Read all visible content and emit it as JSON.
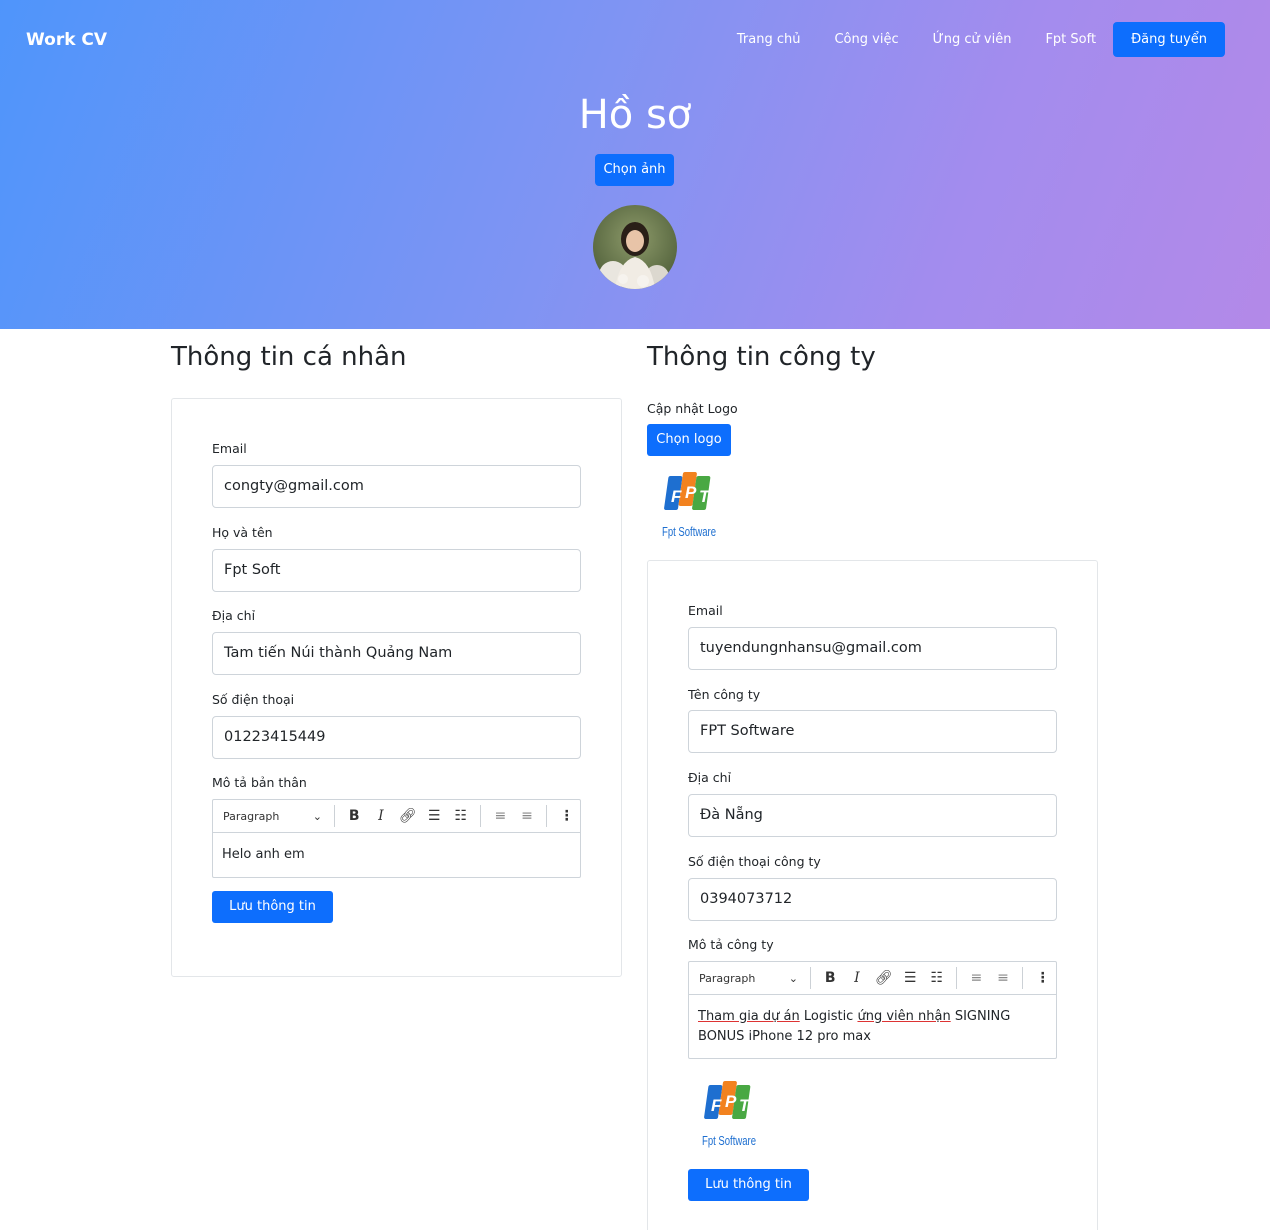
{
  "header": {
    "brand": "Work CV",
    "nav": [
      "Trang chủ",
      "Công việc",
      "Ứng cử viên",
      "Fpt Soft"
    ],
    "post_button": "Đăng tuyển"
  },
  "hero": {
    "title": "Hồ sơ",
    "choose_image_button": "Chọn ảnh"
  },
  "personal": {
    "title": "Thông tin cá nhân",
    "email_label": "Email",
    "email_value": "congty@gmail.com",
    "name_label": "Họ và tên",
    "name_value": "Fpt Soft",
    "address_label": "Địa chỉ",
    "address_value": "Tam tiến Núi thành Quảng Nam",
    "phone_label": "Số điện thoại",
    "phone_value": "01223415449",
    "desc_label": "Mô tả bản thân",
    "desc_value": "Helo anh em",
    "save_button": "Lưu thông tin"
  },
  "editor_toolbar": {
    "paragraph": "Paragraph"
  },
  "company": {
    "title": "Thông tin công ty",
    "logo_label": "Cập nhật Logo",
    "choose_logo_button": "Chọn logo",
    "logo_text": "Fpt Software",
    "email_label": "Email",
    "email_value": "tuyendungnhansu@gmail.com",
    "name_label": "Tên công ty",
    "name_value": "FPT Software",
    "address_label": "Địa chỉ",
    "address_value": "Đà Nẵng",
    "phone_label": "Số điện thoại công ty",
    "phone_value": "0394073712",
    "desc_label": "Mô tả công ty",
    "desc_underlined": "Tham gia dự án",
    "desc_rest": " Logistic ",
    "desc_underlined2": "ứng viên nhận",
    "desc_rest2": " SIGNING BONUS iPhone 12 pro max",
    "save_button": "Lưu thông tin"
  },
  "colors": {
    "primary": "#0d6efd",
    "gradient_start": "#4f95fb",
    "gradient_end": "#b389e8"
  }
}
